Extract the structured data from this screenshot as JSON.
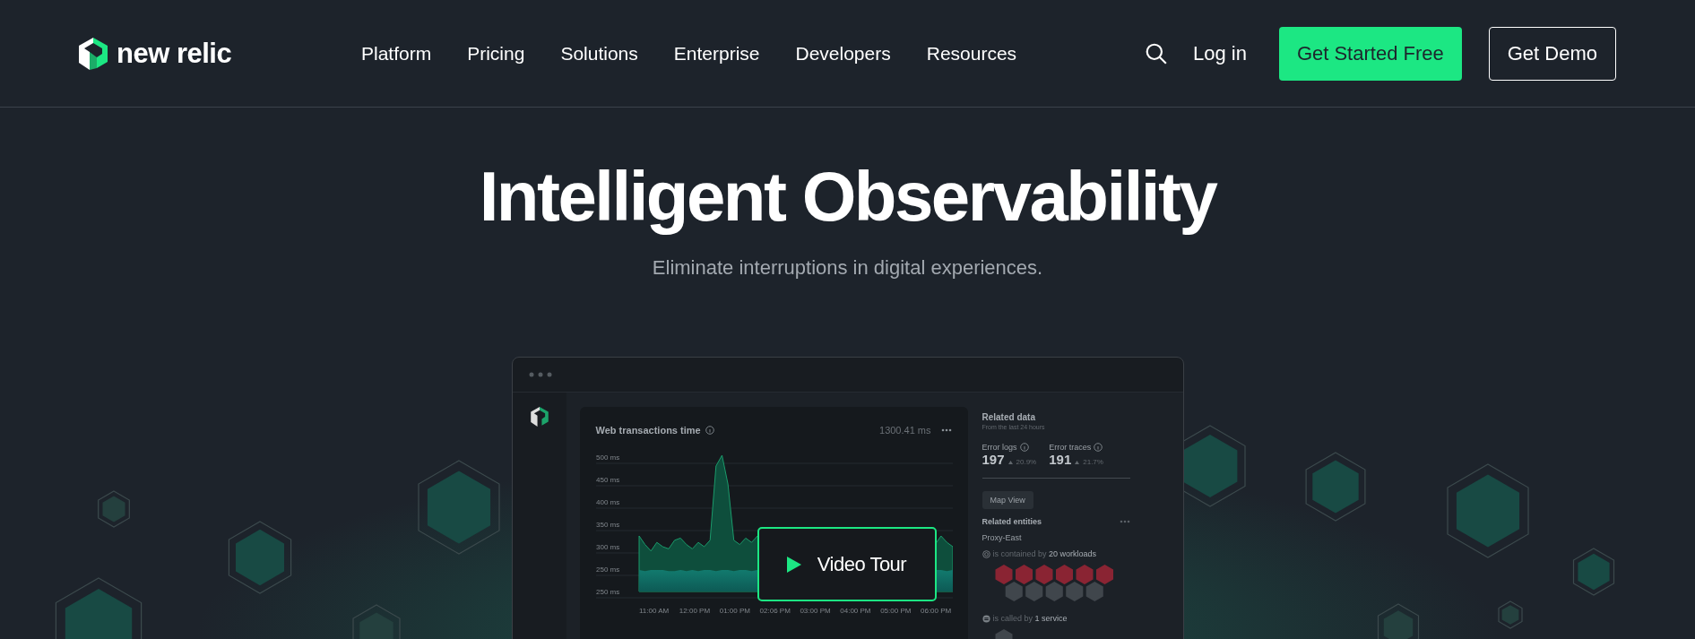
{
  "header": {
    "logo_text": "new relic",
    "nav": [
      {
        "label": "Platform"
      },
      {
        "label": "Pricing"
      },
      {
        "label": "Solutions"
      },
      {
        "label": "Enterprise"
      },
      {
        "label": "Developers"
      },
      {
        "label": "Resources"
      }
    ],
    "login": "Log in",
    "primary_button": "Get Started Free",
    "secondary_button": "Get Demo"
  },
  "hero": {
    "title": "Intelligent Observability",
    "subtitle": "Eliminate interruptions in digital experiences."
  },
  "dashboard": {
    "chart_panel": {
      "title": "Web transactions time",
      "total": "1300.41 ms",
      "y_labels": [
        "500 ms",
        "450 ms",
        "400 ms",
        "350 ms",
        "300 ms",
        "250 ms",
        "250 ms"
      ],
      "x_labels": [
        "11:00 AM",
        "12:00 PM",
        "01:00 PM",
        "02:06 PM",
        "03:00 PM",
        "04:00 PM",
        "05:00 PM",
        "06:00 PM"
      ]
    },
    "video_button": "Video Tour",
    "related": {
      "title": "Related data",
      "subtitle": "From the last 24 hours",
      "metrics": [
        {
          "label": "Error logs",
          "value": "197",
          "change": "20.9%"
        },
        {
          "label": "Error traces",
          "value": "191",
          "change": "21.7%"
        }
      ],
      "map_button": "Map View",
      "entities_title": "Related entities",
      "entity": "Proxy-East",
      "relations": [
        {
          "kind": "workload",
          "text": "is contained by **20 workloads**",
          "hexagons": [
            {
              "color": "#8a2433"
            },
            {
              "color": "#8a2433"
            },
            {
              "color": "#8a2433"
            },
            {
              "color": "#8a2433"
            },
            {
              "color": "#8a2433"
            },
            {
              "color": "#8a2433"
            },
            {
              "color": "#40464c"
            },
            {
              "color": "#40464c"
            },
            {
              "color": "#40464c"
            },
            {
              "color": "#40464c"
            },
            {
              "color": "#40464c"
            }
          ]
        },
        {
          "kind": "service",
          "text": "is called by **1 service**",
          "hexagons": [
            {
              "color": "#40464c"
            }
          ]
        }
      ]
    }
  }
}
